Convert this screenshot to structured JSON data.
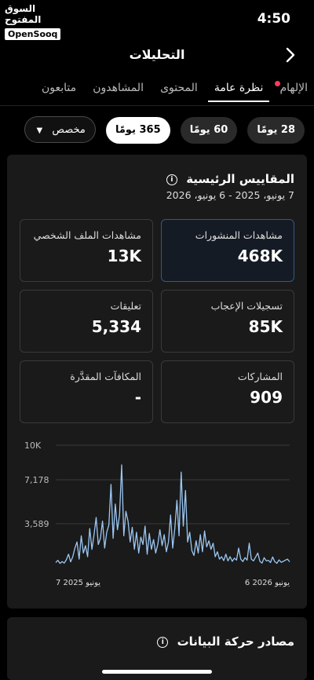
{
  "status": {
    "time": "4:50",
    "watermark_ar": "السوق المفتوح",
    "watermark_brand": "OpenSooq"
  },
  "nav": {
    "title": "التحليلات",
    "back_icon": "chevron-right-icon"
  },
  "tabs": [
    {
      "label": "الإلهام",
      "dot": true
    },
    {
      "label": "نظرة عامة",
      "active": true
    },
    {
      "label": "المحتوى"
    },
    {
      "label": "المشاهدون"
    },
    {
      "label": "متابعون"
    }
  ],
  "ranges": {
    "r28": "28 يومًا",
    "r60": "60 يومًا",
    "r365": "365 يومًا",
    "custom": "مخصص",
    "selected": "365 يومًا"
  },
  "metrics": {
    "title": "المقاييس الرئيسية",
    "date_range": "7 يونيو، 2025 - 6 يونيو، 2026",
    "post_views_label": "مشاهدات المنشورات",
    "post_views": "468K",
    "profile_views_label": "مشاهدات الملف الشخصي",
    "profile_views": "13K",
    "likes_label": "تسجيلات الإعجاب",
    "likes": "85K",
    "comments_label": "تعليقات",
    "comments": "5,334",
    "shares_label": "المشاركات",
    "shares": "909",
    "rewards_label": "المكافآت المقدَّرة",
    "rewards": "-"
  },
  "chart_data": {
    "type": "line",
    "y_ticks": [
      "10K",
      "7,178",
      "3,589"
    ],
    "x_labels": [
      "7 يونيو 2025",
      "6 يونيو 2026"
    ],
    "ylim": [
      0,
      10000
    ],
    "grid": true,
    "line_color": "#9cc7f2",
    "values": [
      420,
      600,
      350,
      500,
      380,
      650,
      1100,
      480,
      900,
      1600,
      2100,
      700,
      2600,
      1200,
      1800,
      900,
      3200,
      1500,
      2700,
      4100,
      1900,
      2400,
      3800,
      1600,
      2900,
      3500,
      6800,
      2400,
      5200,
      3100,
      4300,
      8400,
      2600,
      4600,
      3800,
      2100,
      3300,
      1500,
      2900,
      1200,
      2500,
      1900,
      3400,
      1100,
      2800,
      1500,
      2300,
      1200,
      1900,
      3100,
      1800,
      2700,
      1300,
      2100,
      4300,
      1600,
      3200,
      5500,
      2600,
      7800,
      3400,
      6300,
      2100,
      2900,
      1400,
      1000,
      2200,
      1200,
      2700,
      1300,
      3000,
      1700,
      2200,
      1500,
      2000,
      900,
      1300,
      700,
      900,
      580,
      1100,
      560,
      900,
      520,
      780,
      620,
      1600,
      700,
      500,
      820,
      620,
      2000,
      700,
      560,
      880,
      1200,
      520,
      380,
      820,
      560,
      600,
      420,
      880,
      500,
      360,
      640,
      440,
      520,
      620,
      700,
      480
    ]
  },
  "sources": {
    "title": "مصادر حركة البيانات"
  }
}
